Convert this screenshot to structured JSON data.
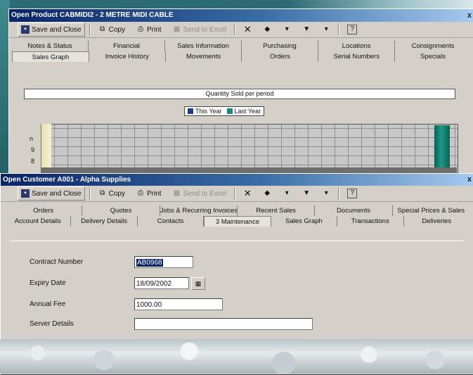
{
  "colors": {
    "this_year": "#1f3f8c",
    "last_year": "#1a8a7a",
    "title_bar": "#0a246a"
  },
  "product_window": {
    "title": "Open Product CABMIDI2 - 2 METRE MIDI CABLE",
    "close_glyph": "x",
    "toolbar": {
      "save_close": "Save and Close",
      "copy": "Copy",
      "print": "Print",
      "send_to_excel": "Send to Excel",
      "delete_glyph": "✕",
      "prev_glyph": "◆",
      "next_glyph": "▼",
      "dropdown_glyph": "▾",
      "help_glyph": "?"
    },
    "tabs_row1": [
      "Notes & Status",
      "Financial",
      "Sales Information",
      "Purchasing",
      "Locations",
      "Consignments"
    ],
    "tabs_row2": [
      "Sales Graph",
      "Invoice History",
      "Movements",
      "Orders",
      "Serial Numbers",
      "Specials"
    ],
    "active_tab": "Sales Graph",
    "chart_title": "Quantity Sold per period",
    "legend": {
      "this_year": "This Year",
      "last_year": "Last Year"
    },
    "axis_ticks": [
      "n",
      "9",
      "8"
    ]
  },
  "customer_window": {
    "title": "Open Customer A001 - Alpha Supplies",
    "close_glyph": "x",
    "toolbar": {
      "save_close": "Save and Close",
      "copy": "Copy",
      "print": "Print",
      "send_to_excel": "Send to Excel",
      "delete_glyph": "✕",
      "prev_glyph": "◆",
      "next_glyph": "▼",
      "dropdown_glyph": "▾",
      "help_glyph": "?"
    },
    "tabs_row1": [
      "Orders",
      "Quotes",
      "Jobs & Recurring Invoices",
      "Recent Sales",
      "Documents",
      "Special Prices & Sales"
    ],
    "tabs_row2": [
      "Account Details",
      "Delivery Details",
      "Contacts",
      "3 Maintenance",
      "Sales Graph",
      "Transactions",
      "Deliveries"
    ],
    "active_tab": "3 Maintenance",
    "fields": {
      "contract_number_label": "Contract Number",
      "contract_number_value": "AB0968",
      "expiry_date_label": "Expiry Date",
      "expiry_date_value": "18/09/2002",
      "annual_fee_label": "Annual Fee",
      "annual_fee_value": "1000.00",
      "server_details_label": "Server Details",
      "server_details_value": ""
    }
  }
}
